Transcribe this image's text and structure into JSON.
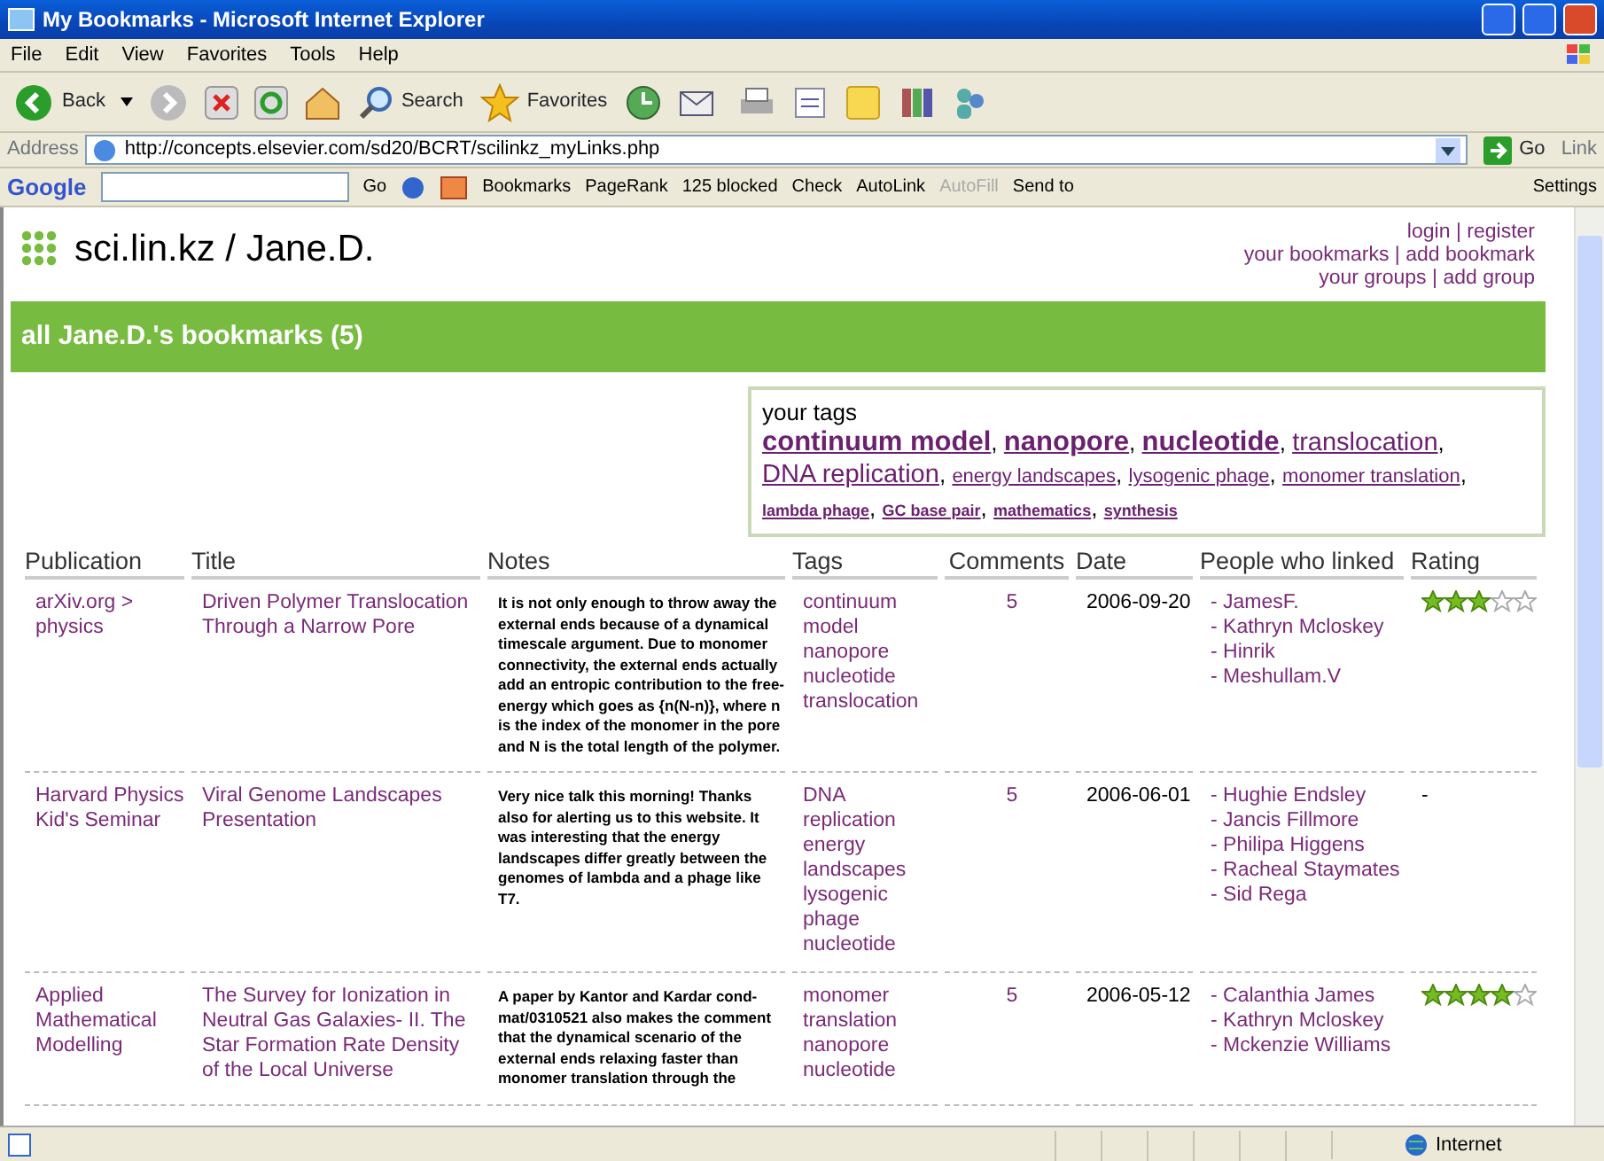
{
  "window": {
    "title": "My Bookmarks - Microsoft Internet Explorer"
  },
  "menu": [
    "File",
    "Edit",
    "View",
    "Favorites",
    "Tools",
    "Help"
  ],
  "toolbar": {
    "back": "Back",
    "search": "Search",
    "favorites": "Favorites"
  },
  "address_bar": {
    "label": "Address",
    "url": "http://concepts.elsevier.com/sd20/BCRT/scilinkz_myLinks.php",
    "go": "Go",
    "links": "Link"
  },
  "google_toolbar": {
    "logo": "Google",
    "go": "Go",
    "items": [
      {
        "label": "Bookmarks",
        "disabled": false
      },
      {
        "label": "PageRank",
        "disabled": false
      },
      {
        "label": "125 blocked",
        "disabled": false
      },
      {
        "label": "Check",
        "disabled": false
      },
      {
        "label": "AutoLink",
        "disabled": false
      },
      {
        "label": "AutoFill",
        "disabled": true
      },
      {
        "label": "Send to",
        "disabled": false
      }
    ],
    "settings": "Settings"
  },
  "site": {
    "title": "sci.lin.kz / Jane.D.",
    "separator": "|",
    "links": [
      [
        "login",
        "register"
      ],
      [
        "your bookmarks",
        "add bookmark"
      ],
      [
        "your groups",
        "add group"
      ]
    ]
  },
  "banner": "all Jane.D.'s bookmarks (5)",
  "your_tags": {
    "heading": "your tags",
    "separator": ",",
    "tags": [
      {
        "label": "continuum model",
        "kind": "top"
      },
      {
        "label": "nanopore",
        "kind": "top"
      },
      {
        "label": "nucleotide",
        "kind": "top"
      },
      {
        "label": "translocation",
        "kind": "frequent"
      },
      {
        "label": "DNA replication",
        "kind": "frequent"
      },
      {
        "label": "energy landscapes",
        "kind": "common"
      },
      {
        "label": "lysogenic phage",
        "kind": "common"
      },
      {
        "label": "monomer translation",
        "kind": "common"
      },
      {
        "label": "lambda phage",
        "kind": "rare"
      },
      {
        "label": "GC base pair",
        "kind": "rare"
      },
      {
        "label": "mathematics",
        "kind": "rare"
      },
      {
        "label": "synthesis",
        "kind": "rare"
      }
    ]
  },
  "table": {
    "columns": [
      "Publication",
      "Title",
      "Notes",
      "Tags",
      "Comments",
      "Date",
      "People who linked",
      "Rating"
    ],
    "rows": [
      {
        "publication": "arXiv.org > physics",
        "title": "Driven Polymer Translocation Through a Narrow Pore",
        "notes": "It is not only enough to throw away the external ends because of a dynamical timescale argument. Due to monomer connectivity, the external ends actually add an entropic contribution to the free-energy which goes as {n(N-n)}, where n is the index of the monomer in the pore and N is the total length of the polymer.",
        "tags": [
          "continuum model",
          "nanopore",
          "nucleotide",
          "translocation"
        ],
        "comments": "5",
        "date": "2006-09-20",
        "people": [
          "- JamesF.",
          "- Kathryn Mcloskey",
          "- Hinrik",
          "- Meshullam.V"
        ],
        "stars": 3
      },
      {
        "publication": "Harvard Physics Kid's Seminar",
        "title": "Viral Genome Landscapes Presentation",
        "notes": "Very nice talk this morning! Thanks also for alerting us to this website. It was interesting that the energy landscapes differ greatly between the genomes of lambda and a phage like T7.",
        "tags": [
          "DNA replication",
          "energy landscapes",
          "lysogenic phage",
          "nucleotide"
        ],
        "comments": "5",
        "date": "2006-06-01",
        "people": [
          "- Hughie Endsley",
          "- Jancis Fillmore",
          "- Philipa Higgens",
          "- Racheal Staymates",
          "- Sid Rega"
        ],
        "rating_text": "-"
      },
      {
        "publication": "Applied Mathematical Modelling",
        "title": "The Survey for Ionization in Neutral Gas Galaxies- II. The Star Formation Rate Density of the Local Universe",
        "notes": "A paper by Kantor and Kardar cond-mat/0310521 also makes the comment that the dynamical scenario of the external ends relaxing faster than monomer translation through the",
        "tags": [
          "monomer translation",
          "nanopore",
          "nucleotide"
        ],
        "comments": "5",
        "date": "2006-05-12",
        "people": [
          "- Calanthia James",
          "- Kathryn Mcloskey",
          "- Mckenzie Williams"
        ],
        "stars": 4
      }
    ]
  },
  "status_bar": {
    "zone": "Internet"
  }
}
